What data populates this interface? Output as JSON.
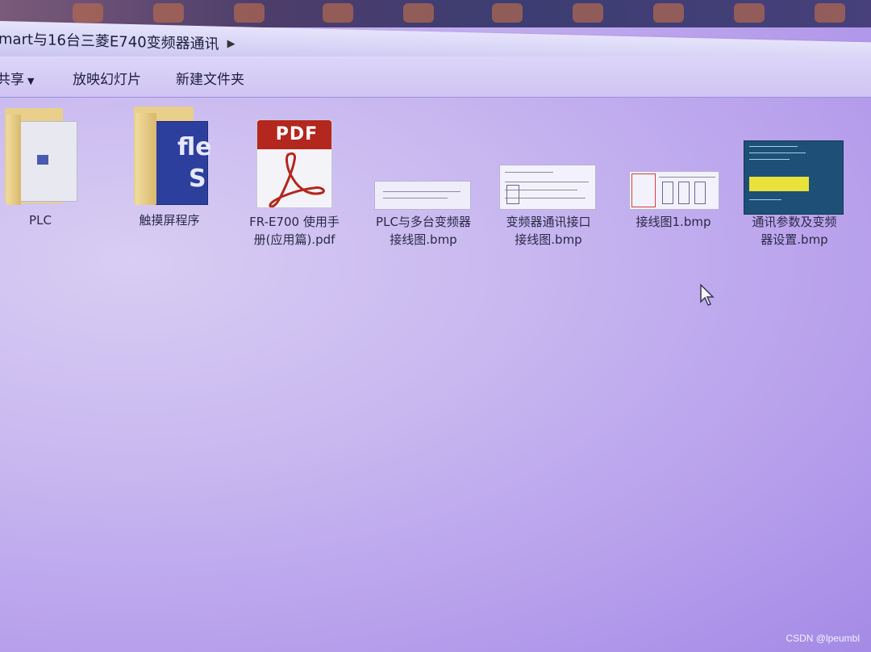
{
  "address_bar": {
    "path_text": "mart与16台三菱E740变频器通讯"
  },
  "toolbar": {
    "share_label": "共享",
    "slideshow_label": "放映幻灯片",
    "new_folder_label": "新建文件夹"
  },
  "files": [
    {
      "name": "PLC",
      "type": "folder"
    },
    {
      "name": "触摸屏程序",
      "type": "folder"
    },
    {
      "name": "FR-E700 使用手\n册(应用篇).pdf",
      "type": "pdf"
    },
    {
      "name": "PLC与多台变频器\n接线图.bmp",
      "type": "bmp"
    },
    {
      "name": "变频器通讯接口\n接线图.bmp",
      "type": "bmp"
    },
    {
      "name": "接线图1.bmp",
      "type": "bmp"
    },
    {
      "name": "通讯参数及变频\n器设置.bmp",
      "type": "bmp"
    }
  ],
  "pdf_icon_text": "PDF",
  "watermark": "CSDN @lpeumbl"
}
